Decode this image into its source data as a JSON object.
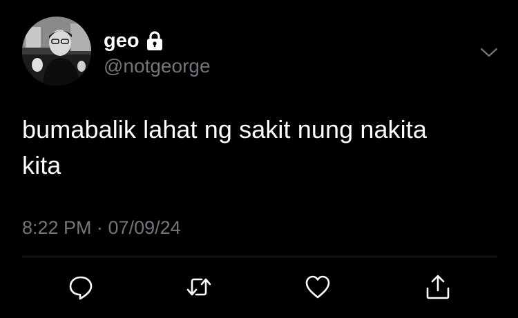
{
  "tweet": {
    "author": {
      "display_name": "geo",
      "handle": "@notgeorge",
      "avatar_icon": "user-avatar",
      "protected_icon": "lock-icon"
    },
    "text_line1": "bumabalik lahat ng sakit nung nakita",
    "text_line2": "kita",
    "timestamp": "8:22 PM · 07/09/24",
    "more_icon": "chevron-down-icon",
    "actions": {
      "reply_icon": "reply-icon",
      "retweet_icon": "retweet-icon",
      "like_icon": "heart-icon",
      "share_icon": "share-icon"
    },
    "colors": {
      "background": "#000000",
      "primary_text": "#ffffff",
      "secondary_text": "#71767b",
      "divider": "#2f3336"
    }
  }
}
